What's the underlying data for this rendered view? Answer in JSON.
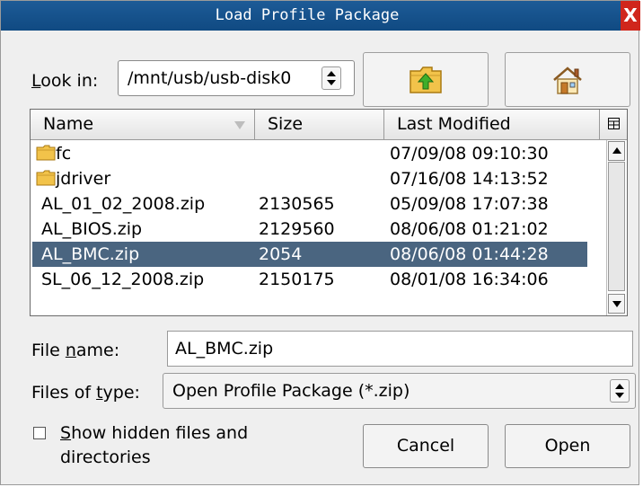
{
  "window": {
    "title": "Load Profile Package",
    "close_glyph": "X"
  },
  "look_in": {
    "label_prefix": "L",
    "label_rest": "ook in:",
    "path": "/mnt/usb/usb-disk0"
  },
  "toolbar": {
    "up_icon": "folder-up-icon",
    "home_icon": "home-icon"
  },
  "list": {
    "columns": {
      "name": "Name",
      "size": "Size",
      "modified": "Last Modified"
    },
    "rows": [
      {
        "name": "fc",
        "size": "",
        "modified": "07/09/08 09:10:30",
        "is_folder": true
      },
      {
        "name": "jdriver",
        "size": "",
        "modified": "07/16/08 14:13:52",
        "is_folder": true
      },
      {
        "name": "AL_01_02_2008.zip",
        "size": "2130565",
        "modified": "05/09/08 17:07:38",
        "is_folder": false
      },
      {
        "name": "AL_BIOS.zip",
        "size": "2129560",
        "modified": "08/06/08 01:21:02",
        "is_folder": false
      },
      {
        "name": "AL_BMC.zip",
        "size": "2054",
        "modified": "08/06/08 01:44:28",
        "is_folder": false,
        "selected": true
      },
      {
        "name": "SL_06_12_2008.zip",
        "size": "2150175",
        "modified": "08/01/08 16:34:06",
        "is_folder": false
      }
    ]
  },
  "file_name": {
    "label_pre": "File ",
    "label_u": "n",
    "label_post": "ame:",
    "value": "AL_BMC.zip"
  },
  "file_type": {
    "label_pre": "Files of ",
    "label_u": "t",
    "label_post": "ype:",
    "value": "Open Profile Package (*.zip)"
  },
  "hidden_files": {
    "label_u": "S",
    "label_line1_rest": "how hidden files and",
    "label_line2": "directories",
    "checked": false
  },
  "buttons": {
    "cancel": "Cancel",
    "open": "Open"
  },
  "colors": {
    "titlebar": "#104a82",
    "selection": "#4a6580",
    "close": "#d0261c"
  }
}
